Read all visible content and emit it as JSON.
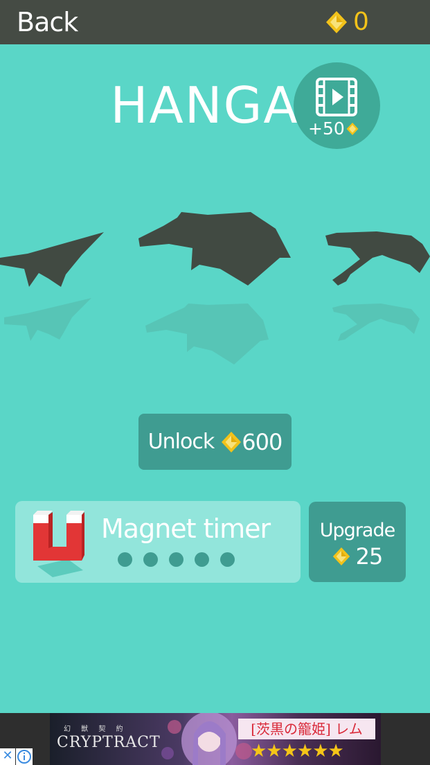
{
  "topbar": {
    "back_label": "Back",
    "gem_icon": "diamond-gem-icon",
    "gem_count": "0"
  },
  "title": "HANGAR",
  "video_reward": {
    "icon": "film-play-icon",
    "reward_text": "+50"
  },
  "planes": [
    {
      "name": "plane-left",
      "state": "locked-silhouette"
    },
    {
      "name": "plane-center",
      "state": "locked-silhouette"
    },
    {
      "name": "plane-right",
      "state": "locked-silhouette"
    }
  ],
  "unlock": {
    "label": "Unlock",
    "price": "600"
  },
  "upgrade": {
    "icon": "magnet-icon",
    "name": "Magnet timer",
    "level": 0,
    "max_level": 5,
    "button_label": "Upgrade",
    "price": "25"
  },
  "ad": {
    "subtitle": "幻 獣 契 約",
    "logo": "CRYPTRACT",
    "headline": "[茨黒の籠姫] レム",
    "stars": "★★★★★★",
    "close_glyph": "✕"
  },
  "colors": {
    "background": "#5ad6c7",
    "topbar": "#454b44",
    "gem": "#f2c21a",
    "button": "#3f9c91",
    "silhouette": "#414a42"
  }
}
